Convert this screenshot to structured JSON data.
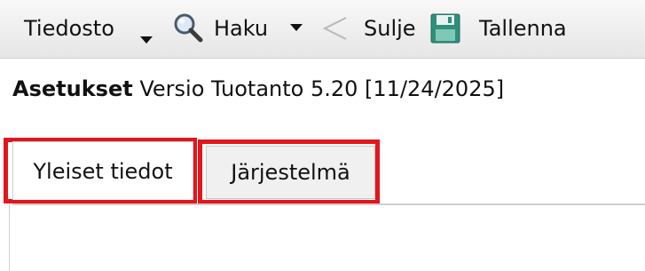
{
  "toolbar": {
    "file_label": "Tiedosto",
    "search_label": "Haku",
    "close_label": "Sulje",
    "save_label": "Tallenna",
    "icons": {
      "file_dropdown": "chevron-down-icon",
      "search": "magnifier-icon",
      "search_dropdown": "chevron-down-icon",
      "close": "back-arrow-icon",
      "save": "floppy-disk-icon"
    }
  },
  "header": {
    "title": "Asetukset",
    "version_text": "Versio Tuotanto 5.20 [11/24/2025]"
  },
  "tabs": [
    {
      "label": "Yleiset tiedot",
      "active": true
    },
    {
      "label": "Järjestelmä",
      "active": false
    }
  ],
  "colors": {
    "highlight_outline": "#e3151d",
    "toolbar_bg": "#efefef",
    "save_icon": "#3aa88f"
  }
}
